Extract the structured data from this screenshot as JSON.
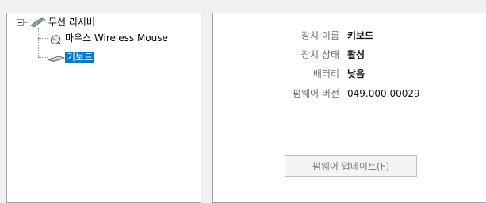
{
  "tree": {
    "root": {
      "label": "무선 리시버",
      "icon": "wireless-receiver-icon",
      "expanded": true
    },
    "children": [
      {
        "label": "마우스 Wireless Mouse",
        "icon": "mouse-icon",
        "selected": false
      },
      {
        "label": "키보드",
        "icon": "keyboard-icon",
        "selected": true
      }
    ]
  },
  "details": {
    "device_name_label": "장치 이름",
    "device_name_value": "키보드",
    "device_status_label": "장치 상태",
    "device_status_value": "활성",
    "battery_label": "배터리",
    "battery_value": "낮음",
    "firmware_label": "펌웨어 버전",
    "firmware_value": "049.000.00029"
  },
  "buttons": {
    "update_firmware": "펌웨어 업데이트(F)",
    "update_firmware_enabled": false
  },
  "colors": {
    "selection": "#0078d7",
    "panel_bg": "#ffffff",
    "window_bg": "#f0f0f0"
  }
}
